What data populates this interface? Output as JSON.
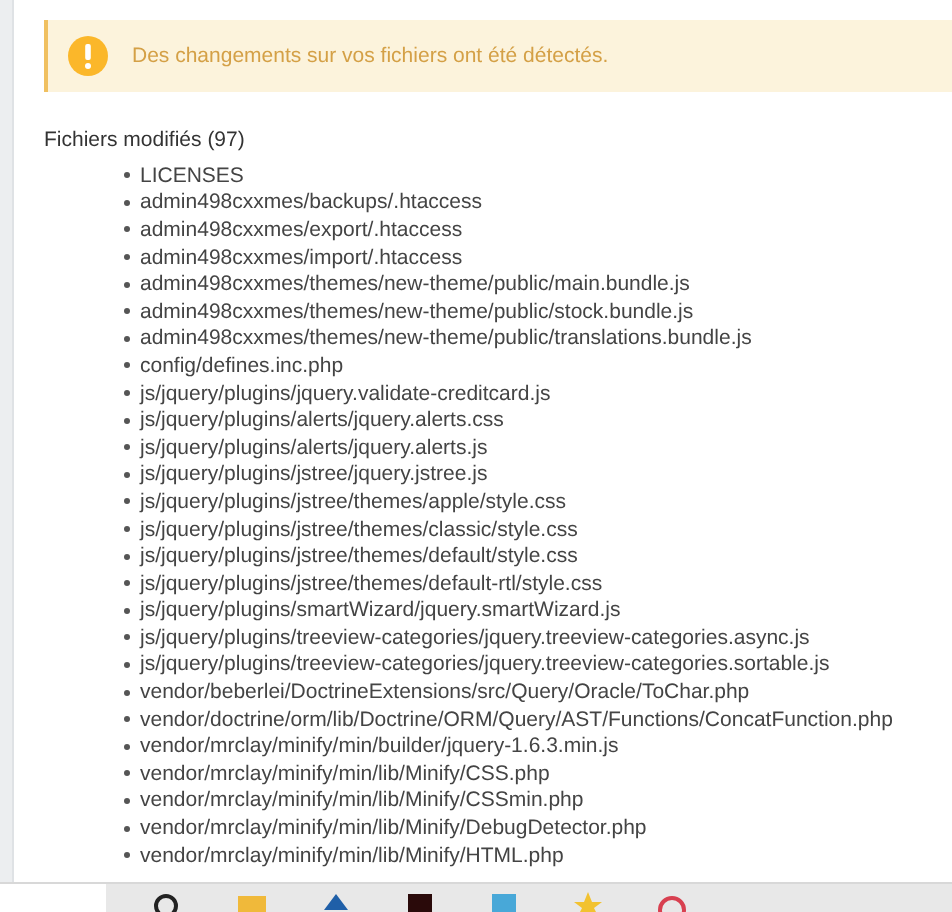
{
  "alert": {
    "kind": "warning",
    "message": "Des changements sur vos fichiers ont été détectés."
  },
  "section": {
    "title": "Fichiers modifiés (97)",
    "files": [
      "LICENSES",
      "admin498cxxmes/backups/.htaccess",
      "admin498cxxmes/export/.htaccess",
      "admin498cxxmes/import/.htaccess",
      "admin498cxxmes/themes/new-theme/public/main.bundle.js",
      "admin498cxxmes/themes/new-theme/public/stock.bundle.js",
      "admin498cxxmes/themes/new-theme/public/translations.bundle.js",
      "config/defines.inc.php",
      "js/jquery/plugins/jquery.validate-creditcard.js",
      "js/jquery/plugins/alerts/jquery.alerts.css",
      "js/jquery/plugins/alerts/jquery.alerts.js",
      "js/jquery/plugins/jstree/jquery.jstree.js",
      "js/jquery/plugins/jstree/themes/apple/style.css",
      "js/jquery/plugins/jstree/themes/classic/style.css",
      "js/jquery/plugins/jstree/themes/default/style.css",
      "js/jquery/plugins/jstree/themes/default-rtl/style.css",
      "js/jquery/plugins/smartWizard/jquery.smartWizard.js",
      "js/jquery/plugins/treeview-categories/jquery.treeview-categories.async.js",
      "js/jquery/plugins/treeview-categories/jquery.treeview-categories.sortable.js",
      "vendor/beberlei/DoctrineExtensions/src/Query/Oracle/ToChar.php",
      "vendor/doctrine/orm/lib/Doctrine/ORM/Query/AST/Functions/ConcatFunction.php",
      "vendor/mrclay/minify/min/builder/jquery-1.6.3.min.js",
      "vendor/mrclay/minify/min/lib/Minify/CSS.php",
      "vendor/mrclay/minify/min/lib/Minify/CSSmin.php",
      "vendor/mrclay/minify/min/lib/Minify/DebugDetector.php",
      "vendor/mrclay/minify/min/lib/Minify/HTML.php"
    ]
  }
}
